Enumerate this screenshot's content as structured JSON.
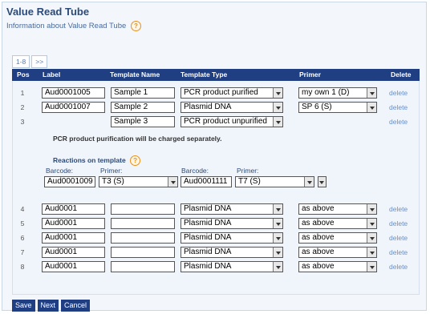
{
  "header": {
    "title": "Value Read Tube",
    "subtitle": "Information about Value Read Tube",
    "help_glyph": "?"
  },
  "pager": {
    "range": "1-8",
    "next": ">>"
  },
  "columns": {
    "pos": "Pos",
    "label": "Label",
    "template_name": "Template Name",
    "template_type": "Template Type",
    "primer": "Primer",
    "delete": "Delete"
  },
  "rows": [
    {
      "pos": "1",
      "label": "Aud0001005",
      "template_name": "Sample 1",
      "template_type": "PCR product purified",
      "primer": "my own 1 (D)",
      "delete": "delete"
    },
    {
      "pos": "2",
      "label": "Aud0001007",
      "template_name": "Sample 2",
      "template_type": "Plasmid DNA",
      "primer": "SP 6 (S)",
      "delete": "delete"
    },
    {
      "pos": "3",
      "label": "",
      "template_name": "Sample 3",
      "template_type": "PCR product unpurified",
      "primer": "",
      "delete": "delete"
    },
    {
      "pos": "4",
      "label": "Aud0001",
      "template_name": "",
      "template_type": "Plasmid DNA",
      "primer": "as above",
      "delete": "delete"
    },
    {
      "pos": "5",
      "label": "Aud0001",
      "template_name": "",
      "template_type": "Plasmid DNA",
      "primer": "as above",
      "delete": "delete"
    },
    {
      "pos": "6",
      "label": "Aud0001",
      "template_name": "",
      "template_type": "Plasmid DNA",
      "primer": "as above",
      "delete": "delete"
    },
    {
      "pos": "7",
      "label": "Aud0001",
      "template_name": "",
      "template_type": "Plasmid DNA",
      "primer": "as above",
      "delete": "delete"
    },
    {
      "pos": "8",
      "label": "Aud0001",
      "template_name": "",
      "template_type": "Plasmid DNA",
      "primer": "as above",
      "delete": "delete"
    }
  ],
  "row3_note": "PCR product purification will be charged separately.",
  "reactions": {
    "title": "Reactions on template",
    "barcode_label": "Barcode:",
    "primer_label": "Primer:",
    "entries": [
      {
        "barcode": "Aud0001009",
        "primer": "T3 (S)"
      },
      {
        "barcode": "Aud0001111",
        "primer": "T7 (S)"
      }
    ],
    "extra_primer": ""
  },
  "buttons": {
    "save": "Save",
    "next": "Next",
    "cancel": "Cancel"
  },
  "colors": {
    "header_bg": "#203f82",
    "title": "#2b4a78",
    "help_icon": "#e8901c",
    "delete_link": "#6a8fc4"
  }
}
